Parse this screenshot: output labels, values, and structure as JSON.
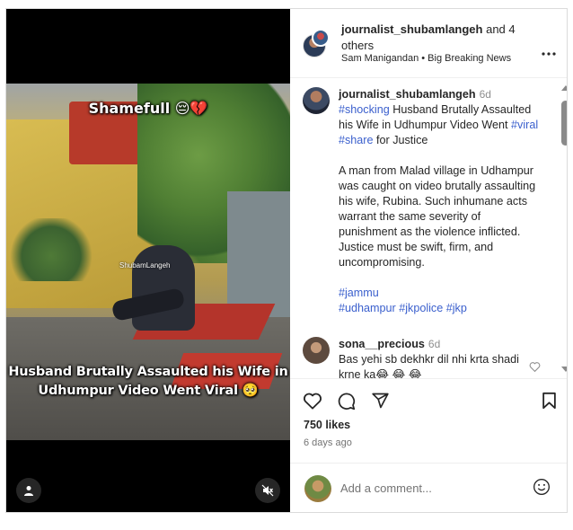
{
  "post": {
    "caption_overlay_top": "Shamefull 😔💔",
    "watermark": "ShubamLangeh",
    "caption_overlay_bottom_line1": "Husband Brutally Assaulted his Wife in",
    "caption_overlay_bottom_line2": "Udhumpur Video Went Viral 🥺"
  },
  "header": {
    "username": "journalist_shubamlangeh",
    "and_others": " and 4 others",
    "subtitle": "Sam Manigandan • Big Breaking News",
    "more_icon": "more-horizontal-icon"
  },
  "caption": {
    "username": "journalist_shubamlangeh",
    "time": "6d",
    "hashtag_shocking": "#shocking",
    "text1": " Husband Brutally Assaulted his Wife in Udhumpur Video Went ",
    "hashtag_viral": "#viral",
    "space": " ",
    "hashtag_share": "#share",
    "text2": " for Justice",
    "paragraph": "A man from Malad village in Udhampur was caught on video brutally assaulting his wife, Rubina. Such inhumane acts warrant the same severity of punishment as the violence inflicted. Justice must be swift, firm, and uncompromising.",
    "hashtag_jammu": "#jammu",
    "hashtag_udhampur": "#udhampur",
    "hashtag_jkpolice": "#jkpolice",
    "hashtag_jkp": "#jkp"
  },
  "comment": {
    "username": "sona__precious",
    "time": "6d",
    "text": "Bas yehi sb dekhkr dil nhi krta shadi krne ka😂 😂 😂"
  },
  "stats": {
    "likes": "750 likes",
    "ago": "6 days ago"
  },
  "composer": {
    "placeholder": "Add a comment..."
  },
  "colors": {
    "link": "#3a5fcd",
    "muted": "#737373",
    "text": "#262626"
  }
}
